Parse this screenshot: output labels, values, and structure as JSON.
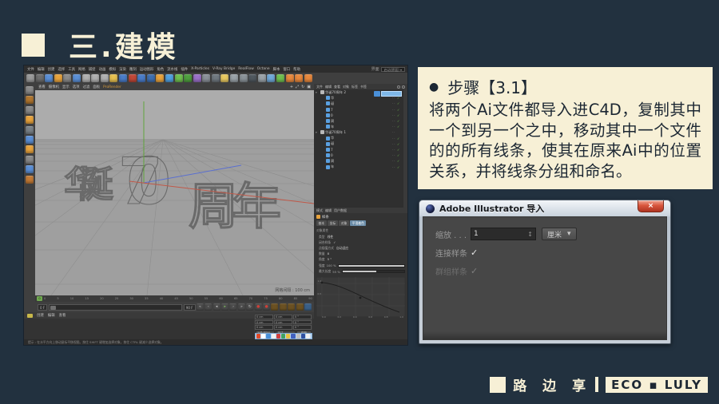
{
  "theme": {
    "bg": "#22313F",
    "cream": "#F7F0D6",
    "ink": "#1C2733"
  },
  "slide": {
    "title": "三.建模"
  },
  "steps": {
    "bullet": "●",
    "heading": "步骤【3.1】",
    "body": "将两个Ai文件都导入进C4D，复制其中一个到另一个之中，移动其中一个文件的的所有线条，使其在原来Ai中的位置关系，并将线条分组和命名。"
  },
  "dialog": {
    "title": "Adobe Illustrator 导入",
    "close": "×",
    "scale_label": "缩放 . . .",
    "scale_value": "1",
    "spinner": "↕",
    "unit": "厘米",
    "unit_arrow": "▾",
    "connect_label": "连接样条",
    "connect_check": "✓",
    "group_label": "群组样条",
    "group_check": "✓"
  },
  "footer": {
    "brand": "路 边 享",
    "badge": "ECO ▪ LULY"
  },
  "c4d": {
    "menubar": [
      "文件",
      "编辑",
      "创建",
      "选择",
      "工具",
      "网格",
      "捕捉",
      "动画",
      "模拟",
      "渲染",
      "雕刻",
      "运动图形",
      "角色",
      "流水线",
      "插件",
      "X-Particles",
      "V-Ray Bridge",
      "RealFlow",
      "Octane",
      "脚本",
      "窗口",
      "帮助"
    ],
    "layout_label": "界面",
    "layout_value": "启动(界面) ▾",
    "toolbar": [
      {
        "n": "undo-icon",
        "c": "#9A9A9A"
      },
      {
        "n": "live-selection-icon",
        "c": "#6E6E6E"
      },
      {
        "n": "move-icon",
        "c": "#5B8FD6"
      },
      {
        "n": "scale-icon",
        "c": "#E8A33D"
      },
      {
        "n": "rotate-icon",
        "c": "#8A8A8A"
      },
      {
        "n": "last-tool-icon",
        "c": "#5B8FD6"
      },
      {
        "n": "x-axis-lock-icon",
        "c": "#B0B0B0"
      },
      {
        "n": "y-axis-lock-icon",
        "c": "#B0B0B0"
      },
      {
        "n": "z-axis-lock-icon",
        "c": "#B0B0B0"
      },
      {
        "n": "coordinate-system-icon",
        "c": "#E8C050"
      },
      {
        "n": "render-view-icon",
        "c": "#4A7CC8"
      },
      {
        "n": "render-region-icon",
        "c": "#C04838"
      },
      {
        "n": "render-settings-icon",
        "c": "#4A7CC8"
      },
      {
        "n": "edit-render-icon",
        "c": "#3F6FB0"
      },
      {
        "n": "cube-primitive-icon",
        "c": "#E8A33D"
      },
      {
        "n": "spline-pen-icon",
        "c": "#50A0E0"
      },
      {
        "n": "subdivision-surface-icon",
        "c": "#6FBF4F"
      },
      {
        "n": "extrude-nurbs-icon",
        "c": "#4F9F3F"
      },
      {
        "n": "bend-deformer-icon",
        "c": "#9A70C8"
      },
      {
        "n": "floor-object-icon",
        "c": "#8A9098"
      },
      {
        "n": "camera-object-icon",
        "c": "#70787F"
      },
      {
        "n": "light-object-icon",
        "c": "#E8C860"
      },
      {
        "n": "sky-object-icon",
        "c": "#9AA2A8"
      },
      {
        "n": "environment-icon",
        "c": "#8A9298"
      },
      {
        "n": "physical-sky-icon",
        "c": "#50585F"
      },
      {
        "n": "volume-icon",
        "c": "#9AA2A8"
      },
      {
        "n": "field-icon",
        "c": "#70A8D8"
      },
      {
        "n": "mograph-icon",
        "c": "#6FBF4F"
      },
      {
        "n": "cloner-icon",
        "c": "#E8883D"
      },
      {
        "n": "effector-icon",
        "c": "#E8883D"
      },
      {
        "n": "tracer-icon",
        "c": "#E8883D"
      }
    ],
    "left_tools": [
      {
        "n": "convert-editable-icon",
        "c": "#8A8A8A"
      },
      {
        "n": "model-mode-icon",
        "c": "#B0762F"
      },
      {
        "n": "texture-mode-icon",
        "c": "#8A8A8A"
      },
      {
        "n": "workplane-icon",
        "c": "#E8A33D"
      },
      {
        "n": "points-mode-icon",
        "c": "#7A8288"
      },
      {
        "n": "edges-mode-icon",
        "c": "#5B8FD6"
      },
      {
        "n": "polygons-mode-icon",
        "c": "#E8A33D"
      },
      {
        "n": "enable-axis-icon",
        "c": "#8A8A8A"
      },
      {
        "n": "viewport-solo-icon",
        "c": "#5B8FD6"
      },
      {
        "n": "snap-icon",
        "c": "#C27A35"
      }
    ],
    "viewport": {
      "menus": [
        "查看",
        "摄像机",
        "显示",
        "选项",
        "过滤",
        "面板"
      ],
      "renderer": "ProRender",
      "pan_icon": "+",
      "zoom_icon": "⤢",
      "rotate_icon": "↻",
      "maximize_icon": "▣",
      "text_left": "华诞",
      "text_mid": "70",
      "text_right": "周年",
      "grid_label": "网格间隔 : 100 cm"
    },
    "object_manager": {
      "menus": [
        "文件",
        "编辑",
        "查看",
        "对象",
        "标签",
        "书签"
      ],
      "rows": [
        {
          "cls": "lv0",
          "arrow": "▾",
          "icon": "#B8B8B8",
          "label": "华诞70周年 2",
          "dots": "··",
          "check": ""
        },
        {
          "cls": "lv1",
          "arrow": "",
          "icon": "#5AA0E0",
          "label": "华",
          "dots": "··",
          "check": "✓"
        },
        {
          "cls": "lv1",
          "arrow": "",
          "icon": "#5AA0E0",
          "label": "诞",
          "dots": "··",
          "check": "✓"
        },
        {
          "cls": "lv1",
          "arrow": "",
          "icon": "#5AA0E0",
          "label": "7",
          "dots": "··",
          "check": "✓"
        },
        {
          "cls": "lv1",
          "arrow": "",
          "icon": "#5AA0E0",
          "label": "0",
          "dots": "··",
          "check": "✓"
        },
        {
          "cls": "lv1",
          "arrow": "",
          "icon": "#5AA0E0",
          "label": "周",
          "dots": "··",
          "check": "✓"
        },
        {
          "cls": "lv1",
          "arrow": "",
          "icon": "#5AA0E0",
          "label": "年",
          "dots": "··",
          "check": "✓"
        },
        {
          "cls": "lv0",
          "arrow": "▾",
          "icon": "#B8B8B8",
          "label": "华诞70周年 1",
          "dots": "··",
          "check": ""
        },
        {
          "cls": "lv1",
          "arrow": "",
          "icon": "#5AA0E0",
          "label": "华",
          "dots": "··",
          "check": "✓"
        },
        {
          "cls": "lv1",
          "arrow": "",
          "icon": "#5AA0E0",
          "label": "诞",
          "dots": "··",
          "check": "✓"
        },
        {
          "cls": "lv1",
          "arrow": "",
          "icon": "#5AA0E0",
          "label": "7",
          "dots": "··",
          "check": "✓"
        },
        {
          "cls": "lv1",
          "arrow": "",
          "icon": "#5AA0E0",
          "label": "0",
          "dots": "··",
          "check": "✓"
        },
        {
          "cls": "lv1",
          "arrow": "",
          "icon": "#5AA0E0",
          "label": "周",
          "dots": "··",
          "check": "✓"
        },
        {
          "cls": "lv1",
          "arrow": "",
          "icon": "#5AA0E0",
          "label": "年",
          "dots": "··",
          "check": "✓"
        }
      ]
    },
    "attributes": {
      "menus": [
        "模式",
        "编辑",
        "用户数据"
      ],
      "obj_label": "样条",
      "tabs": [
        {
          "label": "基本",
          "cls": ""
        },
        {
          "label": "坐标",
          "cls": ""
        },
        {
          "label": "对象",
          "cls": ""
        },
        {
          "label": "平滑着色",
          "cls": "active"
        }
      ],
      "section": "对象属性",
      "fields": [
        {
          "l": "类型",
          "v": "线性"
        },
        {
          "l": "闭合样条",
          "v": "✓"
        },
        {
          "l": "点插值方式",
          "v": "自动适应"
        },
        {
          "l": "数量",
          "v": "8"
        },
        {
          "l": "角度",
          "v": "5 °"
        }
      ],
      "sliders": [
        {
          "l": "强度",
          "v": "100 %",
          "w": "100%"
        },
        {
          "l": "最大长度",
          "v": "55 %",
          "w": "55%"
        }
      ],
      "curve": {
        "yticks": [
          "1.0",
          "0.5"
        ],
        "xticks": [
          "0.0",
          "0.2",
          "0.4",
          "0.6",
          "0.8",
          "1.0"
        ]
      }
    },
    "timeline": {
      "ticks": [
        "0",
        "5",
        "10",
        "15",
        "20",
        "25",
        "30",
        "35",
        "40",
        "45",
        "50",
        "55",
        "60",
        "65",
        "70",
        "75",
        "80",
        "85",
        "90"
      ],
      "playhead": "0",
      "start": "0 F",
      "end": "90 F"
    },
    "transport": [
      {
        "n": "goto-start-button",
        "g": "«",
        "fg": "#C8C8C8",
        "bg": "#4A4A4A"
      },
      {
        "n": "prev-key-button",
        "g": "‹",
        "fg": "#C8C8C8",
        "bg": "#4A4A4A"
      },
      {
        "n": "play-backward-button",
        "g": "◂",
        "fg": "#C8C8C8",
        "bg": "#4A4A4A"
      },
      {
        "n": "play-button",
        "g": "▸",
        "fg": "#7FBF5F",
        "bg": "#4A4A4A"
      },
      {
        "n": "next-key-button",
        "g": "›",
        "fg": "#C8C8C8",
        "bg": "#4A4A4A"
      },
      {
        "n": "goto-end-button",
        "g": "»",
        "fg": "#C8C8C8",
        "bg": "#4A4A4A"
      },
      {
        "n": "loop-button",
        "g": "↻",
        "fg": "#C8C8C8",
        "bg": "#4A4A4A"
      },
      {
        "n": "record-button",
        "g": "●",
        "fg": "#D04038",
        "bg": "#4A4A4A"
      },
      {
        "n": "autokey-button",
        "g": "●",
        "fg": "#D04038",
        "bg": "#4A4A4A"
      },
      {
        "n": "keyframe-position-button",
        "g": "",
        "fg": "#E8A33D",
        "bg": "#6B5122"
      },
      {
        "n": "keyframe-scale-button",
        "g": "",
        "fg": "#E8A33D",
        "bg": "#6B5122"
      },
      {
        "n": "keyframe-rotation-button",
        "g": "",
        "fg": "#E8A33D",
        "bg": "#6B5122"
      },
      {
        "n": "keyframe-parameter-button",
        "g": "",
        "fg": "#E8A33D",
        "bg": "#6B5122"
      },
      {
        "n": "solo-button",
        "g": "",
        "fg": "#9CC8F0",
        "bg": "#3A5F86"
      }
    ],
    "materials": {
      "menus": [
        "创建",
        "编辑",
        "查看"
      ]
    },
    "coords": {
      "rows": [
        {
          "a": "0 cm",
          "b": "0 cm",
          "c": "0 °"
        },
        {
          "a": "0 cm",
          "b": "0 cm",
          "c": "0 °"
        },
        {
          "a": "0 cm",
          "b": "0 cm",
          "c": "0 °"
        }
      ],
      "mode": "对象(相对)",
      "size": "尺寸",
      "apply": "应用"
    },
    "ime": [
      "#E04B2A",
      "#FFFFFF",
      "#4A90D9",
      "#F0F0F0",
      "#D04040",
      "#40A060",
      "#E8C040",
      "#4060C0",
      "#C0C0C0",
      "#3050A0",
      "#F0F0F0"
    ],
    "status": "提示 : 在水平方向上移动鼠标平移视图。按住 SHIFT 键增加选择对象，按住 CTRL 键减少选择对象。"
  }
}
